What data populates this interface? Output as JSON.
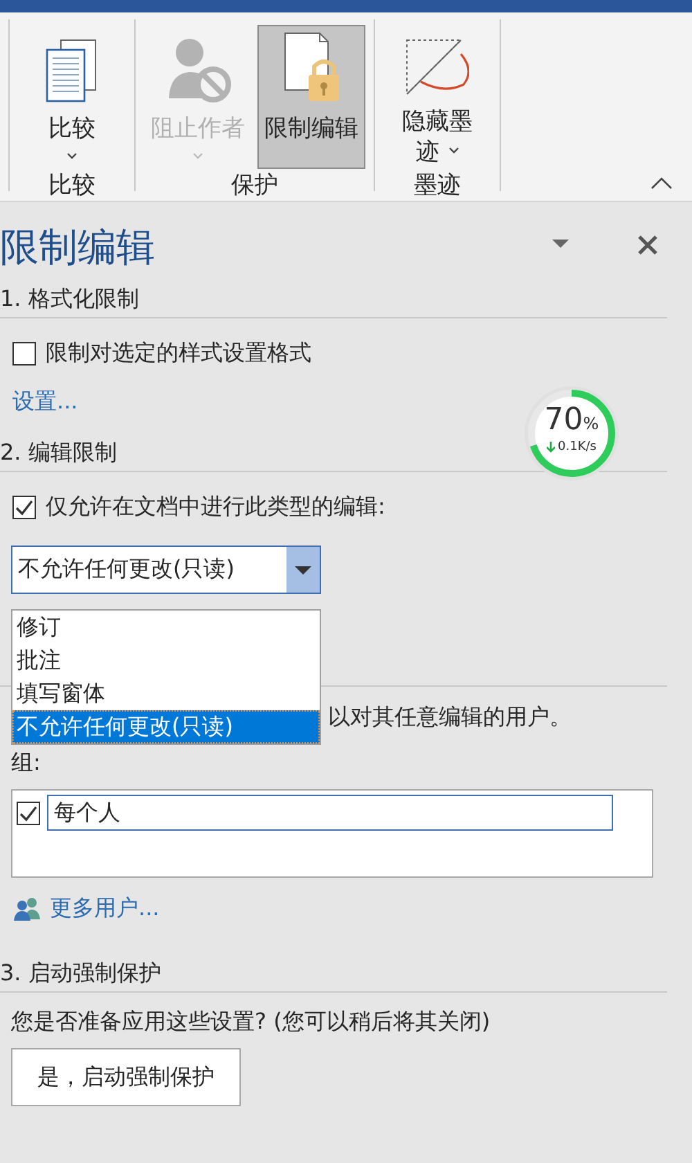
{
  "ribbon": {
    "groups": [
      {
        "label": "比较",
        "buttons": [
          {
            "label": "比较",
            "disabled": false,
            "selected": false,
            "dropdown": true
          }
        ]
      },
      {
        "label": "保护",
        "buttons": [
          {
            "label": "阻止作者",
            "disabled": true,
            "selected": false,
            "dropdown": true
          },
          {
            "label": "限制编辑",
            "disabled": false,
            "selected": true,
            "dropdown": false
          }
        ]
      },
      {
        "label": "墨迹",
        "buttons": [
          {
            "label": "隐藏墨迹",
            "disabled": false,
            "selected": false,
            "dropdown": true
          }
        ]
      }
    ]
  },
  "pane": {
    "title": "限制编辑",
    "section_1": {
      "heading": "1. 格式化限制",
      "option": {
        "label": "限制对选定的样式设置格式",
        "checked": false
      },
      "link": "设置..."
    },
    "section_2": {
      "heading": "2. 编辑限制",
      "option": {
        "label": "仅允许在文档中进行此类型的编辑:",
        "checked": true
      },
      "edit_type": {
        "value": "不允许任何更改(只读)",
        "expanded": true,
        "options": [
          {
            "label": "修订",
            "selected": false
          },
          {
            "label": "批注",
            "selected": false
          },
          {
            "label": "填写窗体",
            "selected": false
          },
          {
            "label": "不允许任何更改(只读)",
            "selected": true
          }
        ]
      },
      "exceptions_text": "以对其任意编辑的用户。",
      "groups_label": "组:",
      "users": [
        {
          "name": "每个人",
          "checked": true
        }
      ],
      "more_users": "更多用户..."
    },
    "section_3": {
      "heading": "3. 启动强制保护",
      "question": "您是否准备应用这些设置? (您可以稍后将其关闭)",
      "button": "是，启动强制保护"
    }
  },
  "speed_meter": {
    "level": 0.7,
    "reading": "70",
    "unit": "%",
    "rate": "0.1K/s"
  }
}
